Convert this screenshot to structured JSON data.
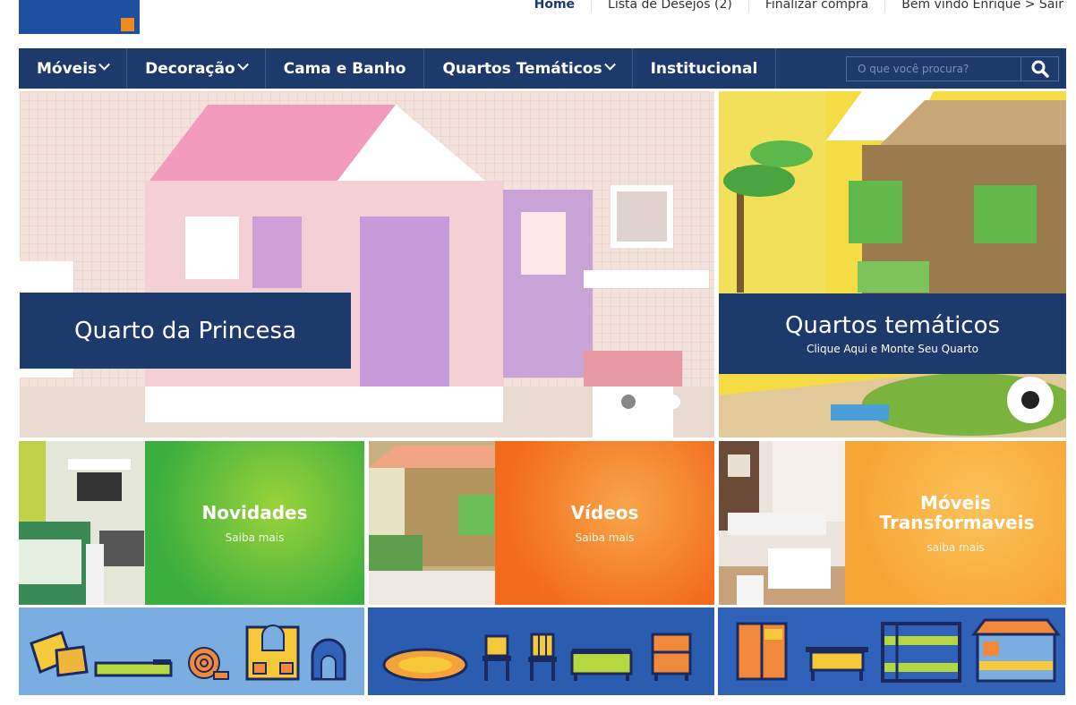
{
  "top_links": [
    "Home",
    "Lista de Desejos (2)",
    "Finalizar compra",
    "Bem vindo  Enrique > Sair"
  ],
  "nav": {
    "items": [
      {
        "label": "Móveis",
        "dropdown": true
      },
      {
        "label": "Decoração",
        "dropdown": true
      },
      {
        "label": "Cama e Banho",
        "dropdown": false
      },
      {
        "label": "Quartos Temáticos",
        "dropdown": true
      },
      {
        "label": "Institucional",
        "dropdown": false
      }
    ],
    "search_placeholder": "O que você procura?"
  },
  "hero": {
    "title": "Quarto da Princesa",
    "slides": 3,
    "active_slide": 1
  },
  "side_banner": {
    "title": "Quartos temáticos",
    "subtitle": "Clique Aqui e Monte Seu Quarto"
  },
  "tiles": [
    {
      "title": "Novidades",
      "link": "Saiba mais",
      "color": "#3cae3f"
    },
    {
      "title": "Vídeos",
      "link": "Saiba mais",
      "color": "#f26a1b"
    },
    {
      "title": "Móveis Transformaveis",
      "link": "saiba mais",
      "color": "#f7a534"
    }
  ],
  "strips": [
    {
      "icons": [
        "pillows-icon",
        "mattress-icon",
        "rug-roll-icon",
        "window-cabinet-icon",
        "tent-icon"
      ],
      "color": "#7aaee0"
    },
    {
      "icons": [
        "oval-rug-icon",
        "chair-icon",
        "chair-icon",
        "toy-box-icon",
        "nightstand-icon"
      ],
      "color": "#2a5db0"
    },
    {
      "icons": [
        "wardrobe-icon",
        "desk-icon",
        "bunk-bed-icon",
        "house-bed-icon"
      ],
      "color": "#2f62b8"
    }
  ]
}
